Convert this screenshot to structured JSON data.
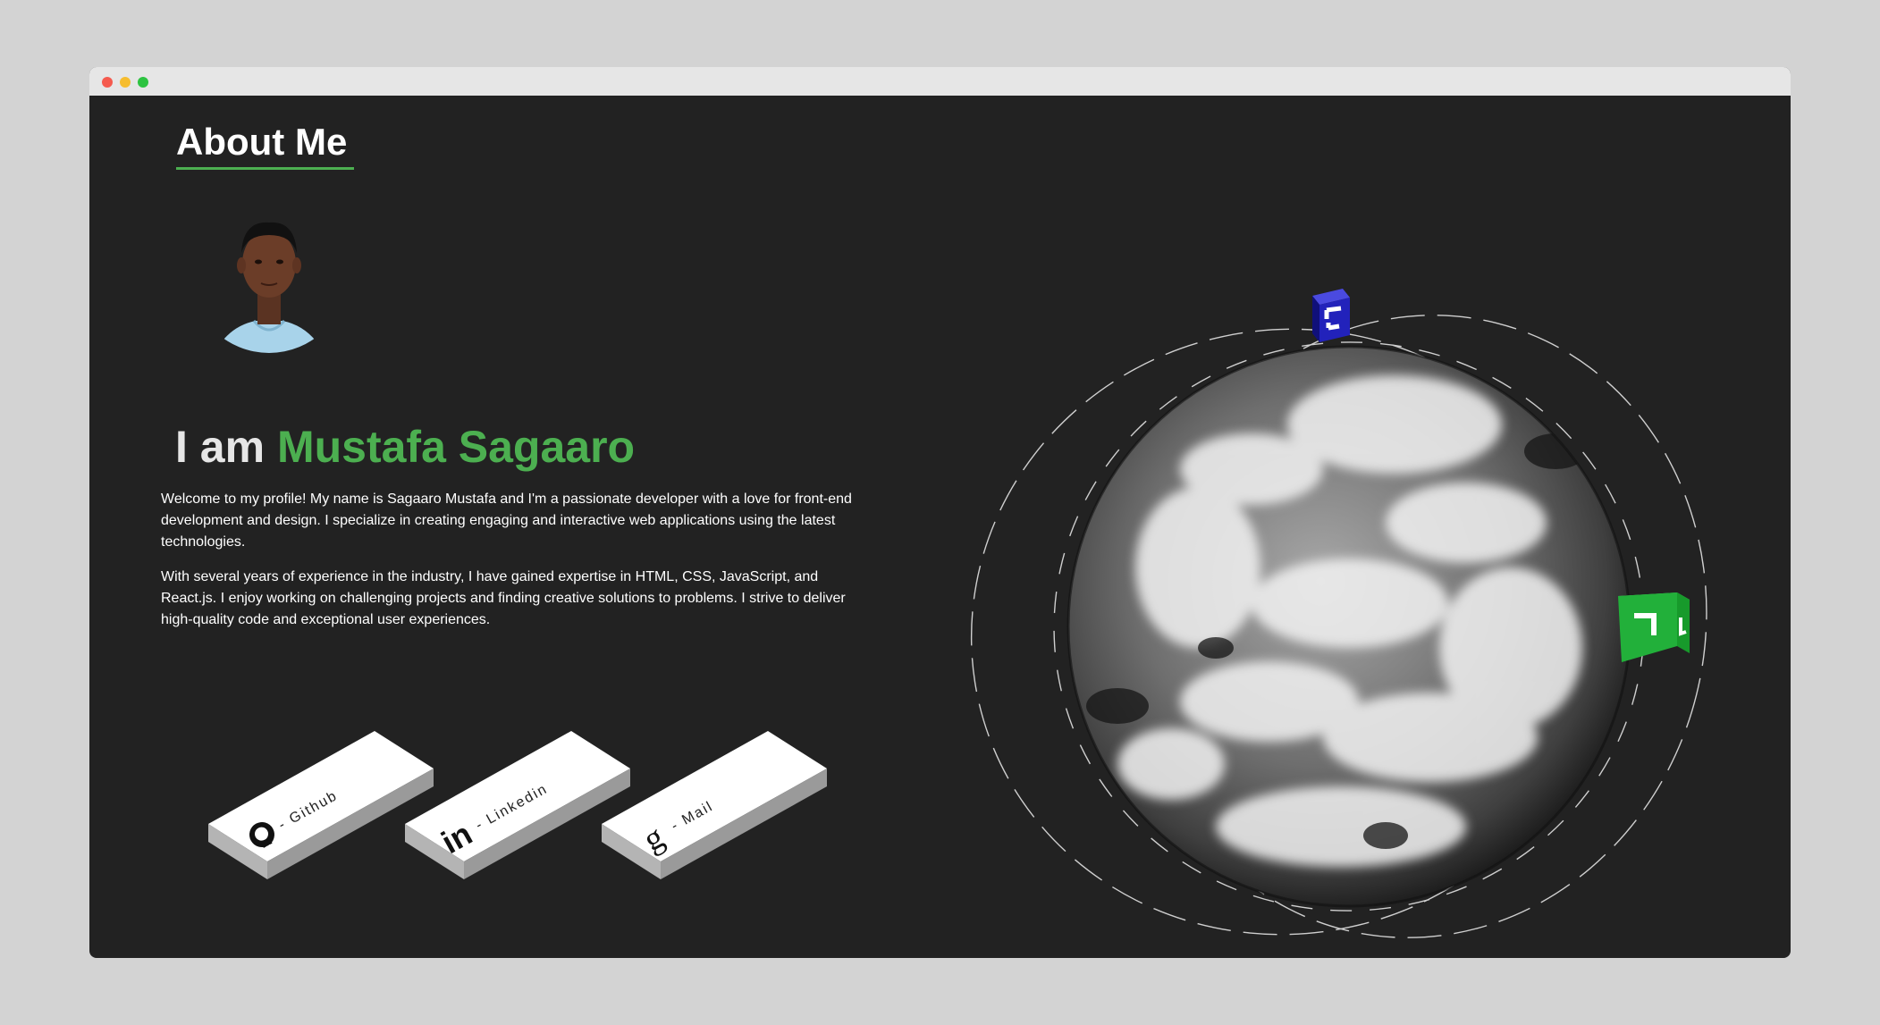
{
  "about": {
    "title": "About Me"
  },
  "hero": {
    "prefix": "I am",
    "name": "Mustafa Sagaaro"
  },
  "bio": {
    "paragraph1": "Welcome to my profile! My name is Sagaaro Mustafa and I'm a passionate developer with a love for front-end development and design. I specialize in creating engaging and interactive web applications using the latest technologies.",
    "paragraph2": "With several years of experience in the industry, I have gained expertise in HTML, CSS, JavaScript, and React.js. I enjoy working on challenging projects and finding creative solutions to problems. I strive to deliver high-quality code and exceptional user experiences."
  },
  "links": [
    {
      "label": "- Github",
      "icon": "github-icon"
    },
    {
      "label": "- Linkedin",
      "icon": "linkedin-icon"
    },
    {
      "label": "- Mail",
      "icon": "google-icon"
    }
  ],
  "colors": {
    "accent": "#4caf50",
    "background": "#222222",
    "blue_cube": "#2222bb",
    "green_cube": "#22b03a"
  }
}
